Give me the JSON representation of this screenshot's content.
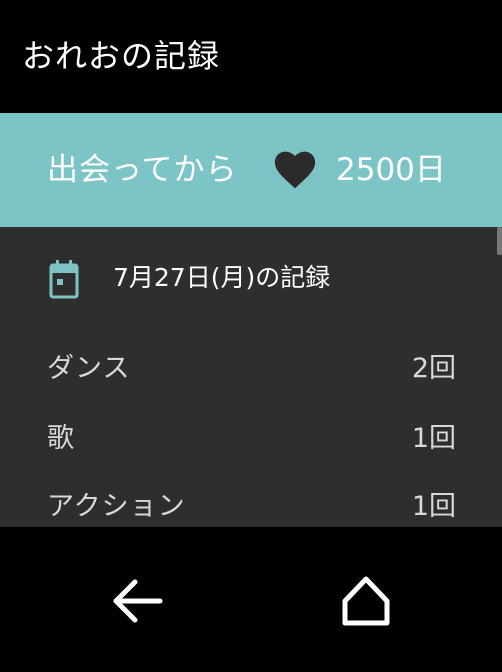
{
  "app_bar": {
    "title": "おれおの記録"
  },
  "banner": {
    "prefix": "出会ってから",
    "icon": "heart-icon",
    "days": "2500日",
    "color": "#7cc4c6"
  },
  "record": {
    "icon": "calendar-icon",
    "date_label": "7月27日(月)の記録",
    "rows": [
      {
        "label": "ダンス",
        "value": "2回"
      },
      {
        "label": "歌",
        "value": "1回"
      },
      {
        "label": "アクション",
        "value": "1回"
      }
    ]
  },
  "nav": {
    "back_icon": "back-arrow-icon",
    "home_icon": "home-icon"
  }
}
